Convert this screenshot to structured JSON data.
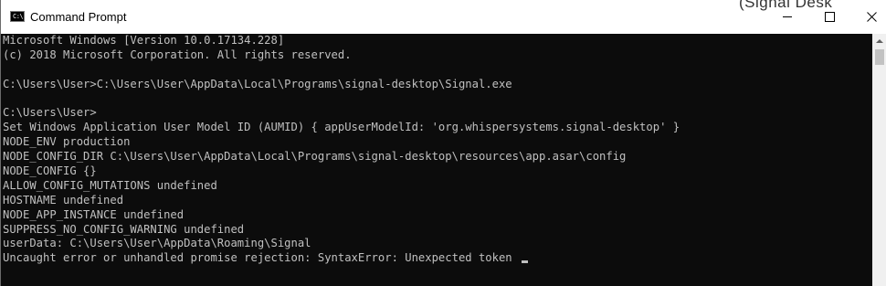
{
  "window": {
    "title": "Command Prompt",
    "icon": "cmd-icon",
    "icon_label": "C:\\",
    "background_title": "(Signal Desk"
  },
  "controls": {
    "minimize": "minimize-icon",
    "maximize": "maximize-icon",
    "close_glyph": "✕"
  },
  "console": {
    "lines": [
      "Microsoft Windows [Version 10.0.17134.228]",
      "(c) 2018 Microsoft Corporation. All rights reserved.",
      "",
      "C:\\Users\\User>C:\\Users\\User\\AppData\\Local\\Programs\\signal-desktop\\Signal.exe",
      "",
      "C:\\Users\\User>",
      "Set Windows Application User Model ID (AUMID) { appUserModelId: 'org.whispersystems.signal-desktop' }",
      "NODE_ENV production",
      "NODE_CONFIG_DIR C:\\Users\\User\\AppData\\Local\\Programs\\signal-desktop\\resources\\app.asar\\config",
      "NODE_CONFIG {}",
      "ALLOW_CONFIG_MUTATIONS undefined",
      "HOSTNAME undefined",
      "NODE_APP_INSTANCE undefined",
      "SUPPRESS_NO_CONFIG_WARNING undefined",
      "userData: C:\\Users\\User\\AppData\\Roaming\\Signal",
      "Uncaught error or unhandled promise rejection: SyntaxError: Unexpected token "
    ]
  },
  "colors": {
    "console_bg": "#0c0c0c",
    "console_text": "#c0c0c0",
    "titlebar_bg": "#ffffff"
  }
}
